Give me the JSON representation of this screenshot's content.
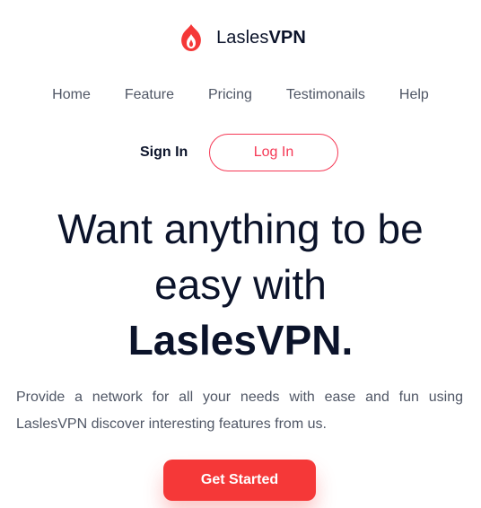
{
  "brand": {
    "name_regular": "Lasles",
    "name_bold": "VPN",
    "icon": "flame-logo-icon",
    "color": "#f53838"
  },
  "nav": {
    "items": [
      {
        "label": "Home"
      },
      {
        "label": "Feature"
      },
      {
        "label": "Pricing"
      },
      {
        "label": "Testimonails"
      },
      {
        "label": "Help"
      }
    ]
  },
  "auth": {
    "signin_label": "Sign In",
    "login_label": "Log In"
  },
  "hero": {
    "headline_lines": [
      "Want anything to be",
      "easy with",
      "LaslesVPN."
    ],
    "description": "Provide a network for all your needs with ease and fun using LaslesVPN discover interesting features from us.",
    "cta_label": "Get Started"
  },
  "colors": {
    "text_dark": "#0b132a",
    "text_muted": "#4f5665",
    "accent": "#f53838",
    "accent_border": "#f53855"
  }
}
